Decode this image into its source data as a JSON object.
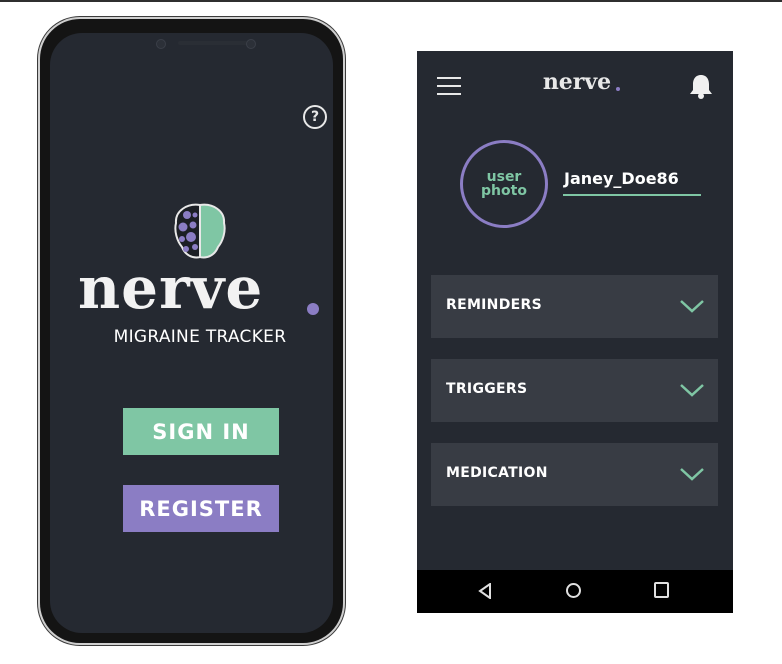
{
  "colors": {
    "bg_dark": "#252931",
    "green": "#7fc6a4",
    "purple": "#8b7dc4",
    "section_bg": "#383c44"
  },
  "splash": {
    "help_icon": "?",
    "logo_icon": "brain-icon",
    "logo_text": "nerve",
    "tagline": "MIGRAINE TRACKER",
    "signin_label": "SIGN IN",
    "register_label": "REGISTER"
  },
  "app": {
    "menu_icon": "hamburger-icon",
    "logo_text": "nerve",
    "bell_icon": "bell-icon",
    "user_photo_line1": "user",
    "user_photo_line2": "photo",
    "username": "Janey_Doe86",
    "sections": [
      {
        "label": "REMINDERS",
        "icon": "chevron-down-icon"
      },
      {
        "label": "TRIGGERS",
        "icon": "chevron-down-icon"
      },
      {
        "label": "MEDICATION",
        "icon": "chevron-down-icon"
      }
    ],
    "navbar": {
      "back_icon": "back-triangle-icon",
      "home_icon": "home-circle-icon",
      "recent_icon": "recent-square-icon"
    }
  }
}
